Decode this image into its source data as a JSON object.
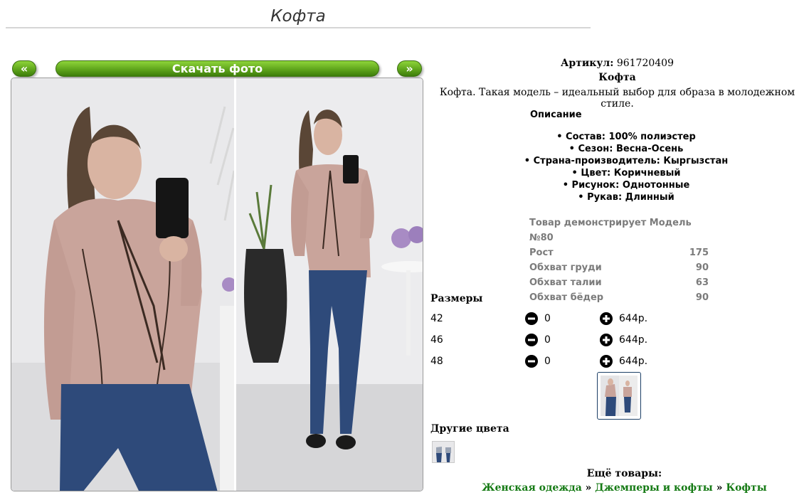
{
  "page": {
    "title": "Кофта"
  },
  "gallery": {
    "prev_label": "«",
    "next_label": "»",
    "download_label": "Скачать фото"
  },
  "product": {
    "sku_label": "Артикул:",
    "sku_value": "961720409",
    "name": "Кофта",
    "description": "Кофта. Такая модель – идеальный выбор для образа в молодежном стиле.",
    "spec_heading": "Описание",
    "specs": [
      "Состав: 100% полиэстер",
      "Сезон: Весна-Осень",
      "Страна-производитель: Кыргызстан",
      "Цвет: Коричневый",
      "Рисунок: Однотонные",
      "Рукав: Длинный"
    ]
  },
  "model": {
    "heading": "Товар демонстрирует Модель №80",
    "rows": [
      {
        "label": "Рост",
        "value": "175"
      },
      {
        "label": "Обхват груди",
        "value": "90"
      },
      {
        "label": "Обхват талии",
        "value": "63"
      },
      {
        "label": "Обхват бёдер",
        "value": "90"
      }
    ]
  },
  "sizes": {
    "heading": "Размеры",
    "rows": [
      {
        "size": "42",
        "qty": "0",
        "price": "644р."
      },
      {
        "size": "46",
        "qty": "0",
        "price": "644р."
      },
      {
        "size": "48",
        "qty": "0",
        "price": "644р."
      }
    ]
  },
  "other_colors": {
    "heading": "Другие цвета"
  },
  "more": {
    "heading": "Ещё товары:",
    "breadcrumb": [
      "Женская одежда",
      "Джемперы и кофты",
      "Кофты"
    ],
    "separator": "»"
  },
  "colors": {
    "accent_green": "#5fa51c",
    "link_green": "#157a14",
    "sweater": "#c9a49b",
    "jeans": "#2e4a7a"
  },
  "icons": [
    "minus-circle-icon",
    "plus-circle-icon"
  ]
}
